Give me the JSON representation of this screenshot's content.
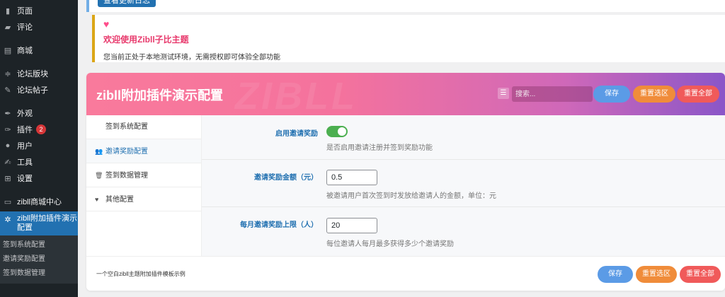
{
  "sidebar": {
    "items": [
      {
        "label": "页面",
        "icon": "pages-icon",
        "glyph": "▮"
      },
      {
        "label": "评论",
        "icon": "comments-icon",
        "glyph": "▰"
      },
      {
        "label": "商城",
        "icon": "store-icon",
        "glyph": "▤"
      },
      {
        "label": "论坛版块",
        "icon": "forum-board-icon",
        "glyph": "≑"
      },
      {
        "label": "论坛帖子",
        "icon": "forum-posts-icon",
        "glyph": "✎"
      },
      {
        "label": "外观",
        "icon": "appearance-icon",
        "glyph": "✒"
      },
      {
        "label": "插件",
        "icon": "plugins-icon",
        "glyph": "✑",
        "badge": "2"
      },
      {
        "label": "用户",
        "icon": "users-icon",
        "glyph": "●"
      },
      {
        "label": "工具",
        "icon": "tools-icon",
        "glyph": "✍"
      },
      {
        "label": "设置",
        "icon": "settings-icon",
        "glyph": "⊞"
      },
      {
        "label": "zibll商城中心",
        "icon": "shop-center-icon",
        "glyph": "▭"
      }
    ],
    "active_item": {
      "label_line1": "zibll附加插件演示",
      "label_line2": "配置",
      "icon": "gear-icon",
      "glyph": "✲"
    },
    "submenu": [
      "签到系统配置",
      "邀请奖励配置",
      "签到数据管理"
    ]
  },
  "notice_top": {
    "button_label": "查看更新日志"
  },
  "welcome": {
    "title": "欢迎使用Zibll子比主题",
    "description": "您当前正处于本地测试环境，无需授权即可体验全部功能"
  },
  "panel": {
    "title": "zibll附加插件演示配置",
    "watermark": "ZIBLL",
    "search_placeholder": "搜索...",
    "buttons": {
      "save": "保存",
      "reset_section": "重置选区",
      "reset_all": "重置全部"
    },
    "nav": [
      {
        "label": "签到系统配置",
        "icon": "",
        "glyph": ""
      },
      {
        "label": "邀请奖励配置",
        "icon": "users-plus-icon",
        "glyph": "👥",
        "active": true
      },
      {
        "label": "签到数据管理",
        "icon": "trash-icon",
        "glyph": "🗑"
      },
      {
        "label": "其他配置",
        "icon": "heart-icon",
        "glyph": "♥"
      }
    ],
    "fields": [
      {
        "label": "启用邀请奖励",
        "type": "toggle",
        "value": "on",
        "description": "是否启用邀请注册并签到奖励功能"
      },
      {
        "label": "邀请奖励金额（元）",
        "type": "number",
        "value": "0.5",
        "description": "被邀请用户首次签到时发放给邀请人的金额，单位：元"
      },
      {
        "label": "每月邀请奖励上限（人）",
        "type": "number",
        "value": "20",
        "description": "每位邀请人每月最多获得多少个邀请奖励"
      }
    ],
    "footer_text": "一个空白zibll主题附加插件模板示例"
  },
  "colors": {
    "sidebar_bg": "#1d2327",
    "active_menu": "#2271b1",
    "header_gradient_start": "#f97a9c",
    "header_gradient_end": "#8a56c8",
    "save_button": "#5b9be6",
    "reset_section_button": "#f08c3a",
    "reset_all_button": "#f05a5a",
    "toggle_on": "#4caf50",
    "welcome_title": "#e8396c"
  }
}
